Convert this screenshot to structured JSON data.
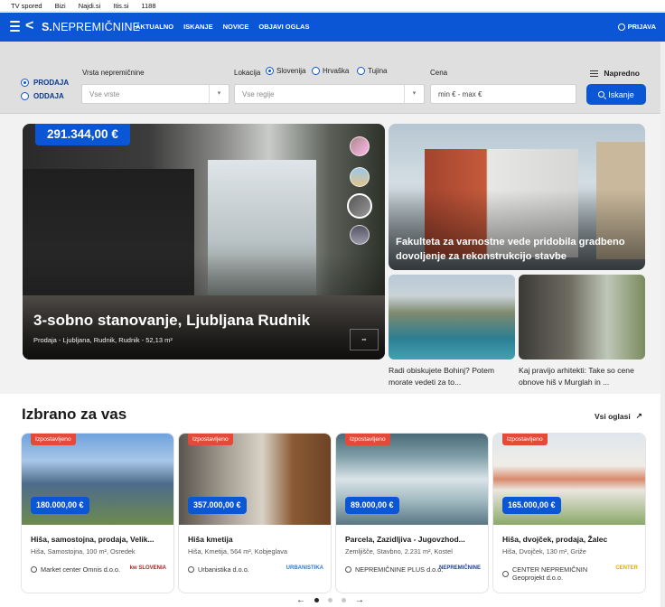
{
  "top_links": [
    "TV spored",
    "Bizi",
    "Najdi.si",
    "Itis.si",
    "1188"
  ],
  "nav": {
    "logo_prefix": "S.",
    "logo_text": "NEPREMIČNINE",
    "menu": [
      "AKTUALNO",
      "ISKANJE",
      "NOVICE",
      "OBJAVI OGLAS"
    ],
    "login": "PRIJAVA"
  },
  "search": {
    "deal_types": [
      "PRODAJA",
      "ODDAJA"
    ],
    "selected_deal": "PRODAJA",
    "property_type_label": "Vrsta nepremičnine",
    "property_type_placeholder": "Vse vrste",
    "location_label": "Lokacija",
    "location_options": [
      "Slovenija",
      "Hrvaška",
      "Tujina"
    ],
    "selected_location": "Slovenija",
    "region_placeholder": "Vse regije",
    "price_label": "Cena",
    "price_placeholder": "min € - max €",
    "advanced": "Napredno",
    "search_button": "Iskanje"
  },
  "hero": {
    "price": "291.344,00 €",
    "title": "3-sobno stanovanje, Ljubljana Rudnik",
    "subtitle": "Prodaja - Ljubljana, Rudnik, Rudnik - 52,13 m²"
  },
  "news": {
    "big_title": "Fakulteta za varnostne vede pridobila gradbeno dovoljenje za rekonstrukcijo stavbe",
    "small": [
      {
        "title": "Radi obiskujete Bohinj? Potem morate vedeti za to..."
      },
      {
        "title": "Kaj pravijo arhitekti: Take so cene obnove hiš v Murglah in ..."
      }
    ]
  },
  "featured": {
    "title": "Izbrano za vas",
    "all_link": "Vsi oglasi",
    "badge": "Izpostavljeno",
    "cards": [
      {
        "price": "180.000,00 €",
        "title": "Hiša, samostojna, prodaja, Velik...",
        "meta": "Hiša, Samostojna, 100 m², Osredek",
        "agent": "Market center Omnis d.o.o.",
        "agent_logo": "kw SLOVENIA"
      },
      {
        "price": "357.000,00 €",
        "title": "Hiša kmetija",
        "meta": "Hiša, Kmetija, 564 m², Kobjeglava",
        "agent": "Urbanistika d.o.o.",
        "agent_logo": "URBANISTIKA"
      },
      {
        "price": "89.000,00 €",
        "title": "Parcela, Zazidljiva - Jugovzhod...",
        "meta": "Zemljišče, Stavbno, 2.231 m², Kostel",
        "agent": "NEPREMIČNINE PLUS d.o.o.",
        "agent_logo": "NEPREMIČNINE"
      },
      {
        "price": "165.000,00 €",
        "title": "Hiša, dvojček, prodaja, Žalec",
        "meta": "Hiša, Dvojček, 130 m², Griže",
        "agent": "CENTER NEPREMIČNIN Geoprojekt d.o.o.",
        "agent_logo": "CENTER"
      }
    ]
  },
  "pager": {
    "prev": "←",
    "next": "→",
    "pages": 3,
    "active": 1
  }
}
